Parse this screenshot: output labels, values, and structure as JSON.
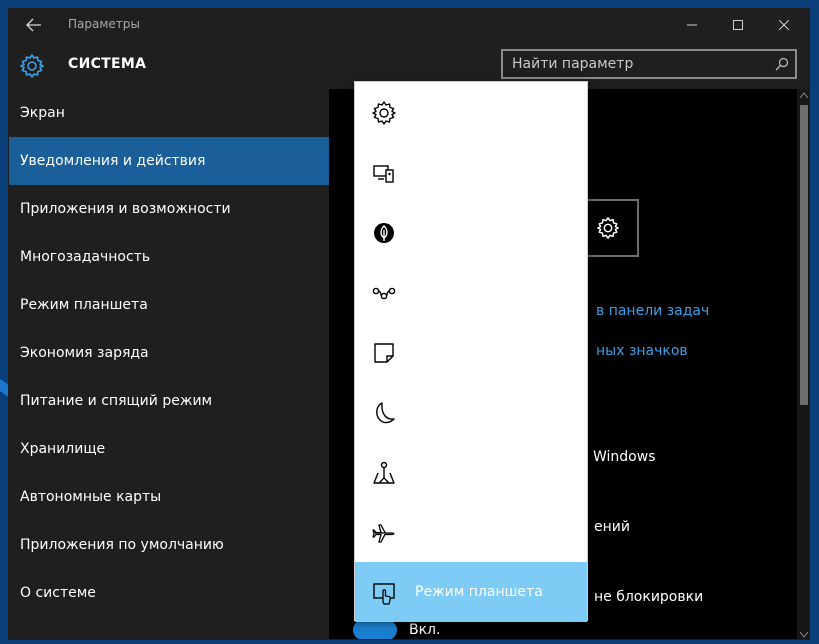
{
  "window": {
    "title": "Параметры"
  },
  "header": {
    "title": "СИСТЕМА"
  },
  "search": {
    "placeholder": "Найти параметр"
  },
  "sidebar": {
    "items": [
      {
        "label": "Экран"
      },
      {
        "label": "Уведомления и действия"
      },
      {
        "label": "Приложения и возможности"
      },
      {
        "label": "Многозадачность"
      },
      {
        "label": "Режим планшета"
      },
      {
        "label": "Экономия заряда"
      },
      {
        "label": "Питание и спящий режим"
      },
      {
        "label": "Хранилище"
      },
      {
        "label": "Автономные карты"
      },
      {
        "label": "Приложения по умолчанию"
      },
      {
        "label": "О системе"
      }
    ],
    "selected": "Уведомления и действия"
  },
  "main": {
    "link1": "в панели задач",
    "link2": "ных значков",
    "text1": "Windows",
    "text2": "ений",
    "text3": "не блокировки",
    "toggle_label": "Вкл."
  },
  "popup": {
    "items": [
      {
        "icon": "gear-icon",
        "label": ""
      },
      {
        "icon": "connect-icon",
        "label": ""
      },
      {
        "icon": "location-icon",
        "label": ""
      },
      {
        "icon": "vpn-icon",
        "label": ""
      },
      {
        "icon": "note-icon",
        "label": ""
      },
      {
        "icon": "moon-icon",
        "label": ""
      },
      {
        "icon": "map-pin-icon",
        "label": ""
      },
      {
        "icon": "airplane-icon",
        "label": ""
      },
      {
        "icon": "tablet-mode-icon",
        "label": "Режим планшета"
      }
    ]
  },
  "colors": {
    "accent": "#1a5f99",
    "link": "#3aa0e8",
    "popup_selected": "#7ecbf5"
  }
}
